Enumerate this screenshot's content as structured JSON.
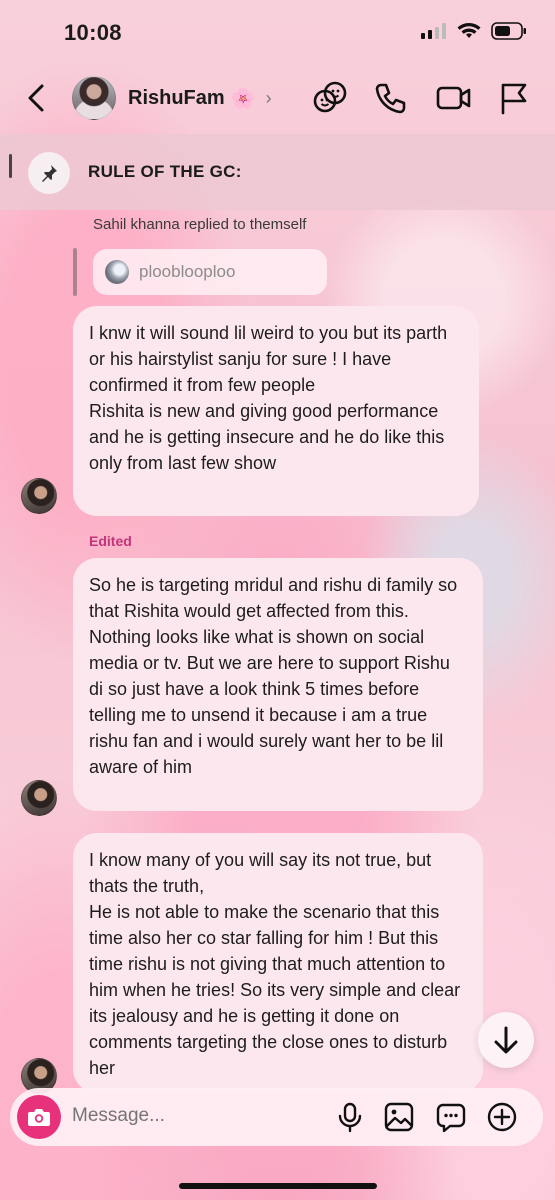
{
  "status_bar": {
    "time": "10:08"
  },
  "header": {
    "chat_name": "RishuFam",
    "chat_emoji": "🌸",
    "chevron": "›",
    "icons": [
      "back-icon",
      "effects-icon",
      "phone-icon",
      "video-icon",
      "flag-icon"
    ]
  },
  "pinned": {
    "text": "RULE OF THE GC:"
  },
  "messages": {
    "reply_caption": "Sahil khanna replied to themself",
    "reply_quote": "plooblooploo",
    "msg1": "I knw it will sound lil weird to you but its parth or his hairstylist sanju for sure ! I have confirmed it from few people\nRishita is new and giving good performance and he is getting insecure and he do like this only from last few show",
    "edited_label": "Edited",
    "msg2": "So he is targeting mridul and rishu di family so that Rishita would get affected from this. Nothing looks like what is shown on social media or tv. But we are here to support Rishu di so just have a look think 5 times before telling me to unsend it because i am a true rishu fan and i would surely want her to be lil aware of him",
    "msg3": "I know many of you will say its not true, but thats the truth,\nHe is not able to make the scenario that this time also her co star falling for him ! But this time rishu is not giving that much attention to him when he tries! So its very simple and clear its jealousy and he is getting it done on comments targeting the close ones to disturb her"
  },
  "composer": {
    "placeholder": "Message..."
  },
  "colors": {
    "accent": "#e8317b",
    "edited": "#c2357a",
    "bubble": "#fde7ee"
  }
}
